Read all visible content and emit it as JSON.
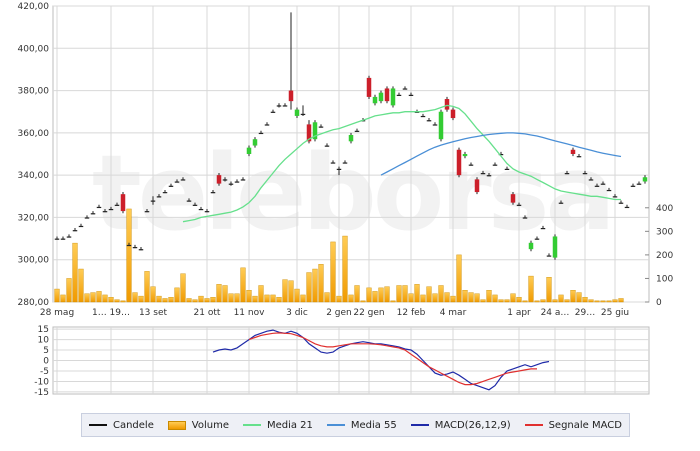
{
  "watermark": "teleborsa",
  "colors": {
    "up": "#33cc33",
    "down": "#cc1f2a",
    "doji": "#222222",
    "volume_top": "#ffcc55",
    "volume_bottom": "#f09a00",
    "media21": "#66e08c",
    "media55": "#4a8fd6",
    "macd": "#1f2aa8",
    "signal": "#e0302f",
    "grid": "#d8d8d8"
  },
  "legend": [
    {
      "label": "Candele",
      "color": "#111111",
      "icon": "line-swatch"
    },
    {
      "label": "Volume",
      "color": "#f5a800",
      "icon": "bar-swatch"
    },
    {
      "label": "Media 21",
      "color": "#66e08c",
      "icon": "line-swatch"
    },
    {
      "label": "Media 55",
      "color": "#4a8fd6",
      "icon": "line-swatch"
    },
    {
      "label": "MACD(26,12,9)",
      "color": "#1f2aa8",
      "icon": "line-swatch"
    },
    {
      "label": "Segnale MACD",
      "color": "#e0302f",
      "icon": "line-swatch"
    }
  ],
  "chart_data": [
    {
      "type": "candlestick",
      "panel": "price",
      "title": "",
      "x_tick_labels": [
        "28 mag",
        "1… 19…",
        "13 set",
        "21 ott",
        "11 nov",
        "3 dic",
        "2 gen",
        "22 gen",
        "12 feb",
        "4 mar",
        "1 apr",
        "24 a…",
        "29…",
        "25 giu"
      ],
      "x_tick_index": [
        0,
        9,
        16,
        25,
        32,
        40,
        47,
        52,
        59,
        66,
        77,
        83,
        88,
        93
      ],
      "y_ticks": [
        "280,00",
        "300,00",
        "320,00",
        "340,00",
        "360,00",
        "380,00",
        "400,00",
        "420,00"
      ],
      "ylim": [
        280,
        420
      ],
      "grid": true,
      "candles": [
        [
          310,
          310,
          309.5,
          311
        ],
        [
          310,
          310,
          309.5,
          311
        ],
        [
          311,
          311,
          310.5,
          312
        ],
        [
          314,
          314,
          313.5,
          315
        ],
        [
          316,
          316,
          315.5,
          317
        ],
        [
          320,
          320,
          319.5,
          321
        ],
        [
          322,
          322,
          321.5,
          323
        ],
        [
          325,
          325,
          324.5,
          326
        ],
        [
          323,
          323,
          322.5,
          324
        ],
        [
          324,
          324,
          323.5,
          325
        ],
        [
          326,
          326,
          325.5,
          327
        ],
        [
          331,
          323,
          322,
          332
        ],
        [
          307,
          307,
          306.5,
          308
        ],
        [
          306,
          306,
          305.5,
          307
        ],
        [
          305,
          305,
          304.5,
          306
        ],
        [
          323,
          323,
          322.5,
          324
        ],
        [
          328,
          328,
          326,
          330
        ],
        [
          330,
          330,
          329.5,
          331
        ],
        [
          332,
          332,
          331.5,
          333
        ],
        [
          335,
          335,
          334.5,
          336
        ],
        [
          337,
          337,
          336.5,
          338
        ],
        [
          338,
          338,
          337.5,
          339
        ],
        [
          328,
          328,
          327.5,
          329
        ],
        [
          326,
          326,
          325.5,
          327
        ],
        [
          324,
          324,
          323.5,
          325
        ],
        [
          323,
          323,
          322.5,
          324
        ],
        [
          332,
          332,
          331.5,
          333
        ],
        [
          340,
          336,
          335,
          341
        ],
        [
          338,
          338,
          337,
          339
        ],
        [
          336,
          336,
          335,
          337
        ],
        [
          337,
          337,
          336.5,
          338
        ],
        [
          338,
          338,
          337.5,
          339
        ],
        [
          350,
          353,
          349,
          354
        ],
        [
          354,
          357,
          353,
          358
        ],
        [
          360,
          360,
          359.5,
          361
        ],
        [
          364,
          364,
          363.5,
          365
        ],
        [
          370,
          370,
          369.5,
          371
        ],
        [
          373,
          373,
          372,
          374
        ],
        [
          373,
          373,
          372.5,
          374
        ],
        [
          380,
          375,
          371,
          417
        ],
        [
          368,
          371,
          367,
          372
        ],
        [
          369,
          369,
          368,
          373
        ],
        [
          364,
          356,
          355,
          366
        ],
        [
          357,
          365,
          356,
          366
        ],
        [
          363,
          363,
          362.5,
          364
        ],
        [
          354,
          354,
          353.5,
          355
        ],
        [
          346,
          346,
          345.5,
          347
        ],
        [
          343,
          343,
          340,
          344
        ],
        [
          346,
          346,
          345.5,
          347
        ],
        [
          356,
          359,
          355,
          360
        ],
        [
          361,
          361,
          360.5,
          362
        ],
        [
          366,
          366,
          365.5,
          367
        ],
        [
          386,
          377,
          376,
          387
        ],
        [
          374,
          377,
          373,
          378
        ],
        [
          375,
          379,
          374,
          380
        ],
        [
          381,
          375,
          374,
          382
        ],
        [
          373,
          381,
          372,
          382
        ],
        [
          378,
          378,
          377.5,
          379
        ],
        [
          381,
          381,
          380.5,
          382
        ],
        [
          378,
          378,
          377.5,
          379
        ],
        [
          370,
          370,
          369.5,
          371
        ],
        [
          368,
          368,
          367.5,
          369
        ],
        [
          366,
          366,
          365.5,
          367
        ],
        [
          364,
          364,
          363.5,
          365
        ],
        [
          357,
          370,
          356,
          371
        ],
        [
          376,
          371,
          370,
          377
        ],
        [
          371,
          367,
          366,
          372
        ],
        [
          352,
          340,
          339,
          353
        ],
        [
          349,
          350,
          348,
          351
        ],
        [
          345,
          345,
          344.5,
          346
        ],
        [
          338,
          332,
          331,
          339
        ],
        [
          341,
          341,
          340.5,
          342
        ],
        [
          340,
          340,
          339.5,
          341
        ],
        [
          345,
          345,
          344.5,
          346
        ],
        [
          350,
          350,
          349.5,
          351
        ],
        [
          343,
          343,
          342.5,
          344
        ],
        [
          331,
          327,
          326,
          332
        ],
        [
          326,
          326,
          325.5,
          327
        ],
        [
          320,
          320,
          319.5,
          321
        ],
        [
          305,
          308,
          304,
          309
        ],
        [
          310,
          310,
          309.5,
          311
        ],
        [
          315,
          315,
          314.5,
          316
        ],
        [
          302,
          302,
          301.5,
          303
        ],
        [
          301,
          311,
          300,
          312
        ],
        [
          327,
          327,
          326.5,
          328
        ],
        [
          341,
          341,
          340.5,
          342
        ],
        [
          352,
          350,
          349,
          353
        ],
        [
          349,
          349,
          348.5,
          350
        ],
        [
          341,
          341,
          340.5,
          342
        ],
        [
          338,
          338,
          337.5,
          339
        ],
        [
          335,
          335,
          334.5,
          336
        ],
        [
          336,
          336,
          335.5,
          337
        ],
        [
          333,
          333,
          332.5,
          334
        ],
        [
          330,
          330,
          329.5,
          331
        ],
        [
          327,
          327,
          326.5,
          328
        ],
        [
          325,
          325,
          324.5,
          326
        ],
        [
          335,
          335,
          334.5,
          336
        ],
        [
          336,
          336,
          335.5,
          337
        ],
        [
          337,
          339,
          336,
          340
        ]
      ],
      "media_21": {
        "name": "Media 21",
        "start_index": 21,
        "values": [
          318,
          318.5,
          319,
          320,
          320.5,
          321,
          321.5,
          322,
          322.5,
          323.5,
          325,
          327,
          330,
          334,
          337.5,
          341,
          344.5,
          347.5,
          350,
          352.5,
          355,
          357,
          358.5,
          359.5,
          360.5,
          361.5,
          362,
          363,
          364,
          365,
          366,
          367,
          368,
          368.5,
          369,
          369.5,
          369.5,
          370,
          370,
          370,
          370,
          370.5,
          371,
          372,
          373,
          372.5,
          371.5,
          369,
          365.5,
          362,
          359,
          356,
          352.5,
          349,
          345.5,
          343,
          341.5,
          340.5,
          339.5,
          338,
          336.5,
          335,
          333.5,
          332.5,
          332,
          331.5,
          331,
          330.5,
          330,
          330,
          329.5,
          329,
          328.5,
          328.5
        ]
      },
      "media_55": {
        "name": "Media 55",
        "start_index": 54,
        "values": [
          340,
          341.5,
          343,
          344.5,
          346,
          347.5,
          349,
          350.5,
          352,
          353.2,
          354.2,
          355,
          355.8,
          356.5,
          357.2,
          357.8,
          358.3,
          358.8,
          359.2,
          359.5,
          359.8,
          360,
          360,
          359.8,
          359.5,
          359,
          358.5,
          357.8,
          357,
          356.2,
          355.5,
          354.8,
          354,
          353.2,
          352.5,
          351.8,
          351,
          350.4,
          349.8,
          349.3,
          348.8
        ]
      }
    },
    {
      "type": "bar",
      "panel": "volume",
      "name": "Volume",
      "y_ticks": [
        "0",
        "100",
        "200",
        "300",
        "400"
      ],
      "ylim": [
        0,
        450
      ],
      "values": [
        55,
        30,
        100,
        250,
        140,
        35,
        40,
        45,
        30,
        20,
        10,
        5,
        395,
        40,
        25,
        130,
        65,
        25,
        15,
        20,
        60,
        120,
        15,
        10,
        25,
        15,
        20,
        75,
        70,
        35,
        35,
        145,
        50,
        25,
        70,
        30,
        30,
        20,
        95,
        90,
        55,
        30,
        125,
        140,
        160,
        40,
        255,
        25,
        280,
        30,
        70,
        5,
        60,
        45,
        60,
        65,
        5,
        70,
        70,
        35,
        75,
        30,
        65,
        35,
        70,
        40,
        25,
        200,
        50,
        40,
        35,
        10,
        50,
        30,
        10,
        10,
        35,
        20,
        5,
        110,
        5,
        10,
        105,
        10,
        30,
        10,
        50,
        40,
        20,
        10,
        5,
        5,
        5,
        10,
        15
      ]
    },
    {
      "type": "line",
      "panel": "macd",
      "y_ticks": [
        "-15",
        "-10",
        "-5",
        "0",
        "5",
        "10",
        "15"
      ],
      "ylim": [
        -16,
        16
      ],
      "series": [
        {
          "name": "MACD(26,12,9)",
          "start_index": 26,
          "values": [
            4,
            5,
            5.5,
            5,
            6,
            8,
            10,
            12,
            13,
            14,
            14.5,
            13.5,
            13,
            14,
            13,
            11,
            8,
            6,
            4,
            3.5,
            4,
            6,
            7,
            8,
            8.5,
            9,
            8.5,
            8,
            8,
            7.5,
            7,
            6.5,
            5.5,
            5,
            3,
            0,
            -3,
            -6,
            -7,
            -6.5,
            -5.5,
            -7,
            -9,
            -11,
            -12,
            -13,
            -14,
            -12,
            -8,
            -5,
            -4,
            -3,
            -2,
            -3,
            -2,
            -1,
            -0.5
          ]
        },
        {
          "name": "Segnale MACD",
          "start_index": 32,
          "values": [
            10,
            11,
            12,
            12.5,
            13,
            13.2,
            13,
            12.8,
            12,
            11,
            9.5,
            8,
            7,
            6.5,
            6.5,
            7,
            7.5,
            8,
            8,
            8,
            8,
            7.8,
            7.5,
            7,
            6.5,
            6,
            5,
            3,
            1,
            -1,
            -3,
            -4.5,
            -6,
            -7.5,
            -9,
            -10.5,
            -11.5,
            -11.5,
            -11,
            -10,
            -9,
            -8,
            -7,
            -6,
            -5.5,
            -5,
            -4.5,
            -4,
            -4
          ]
        }
      ]
    }
  ]
}
